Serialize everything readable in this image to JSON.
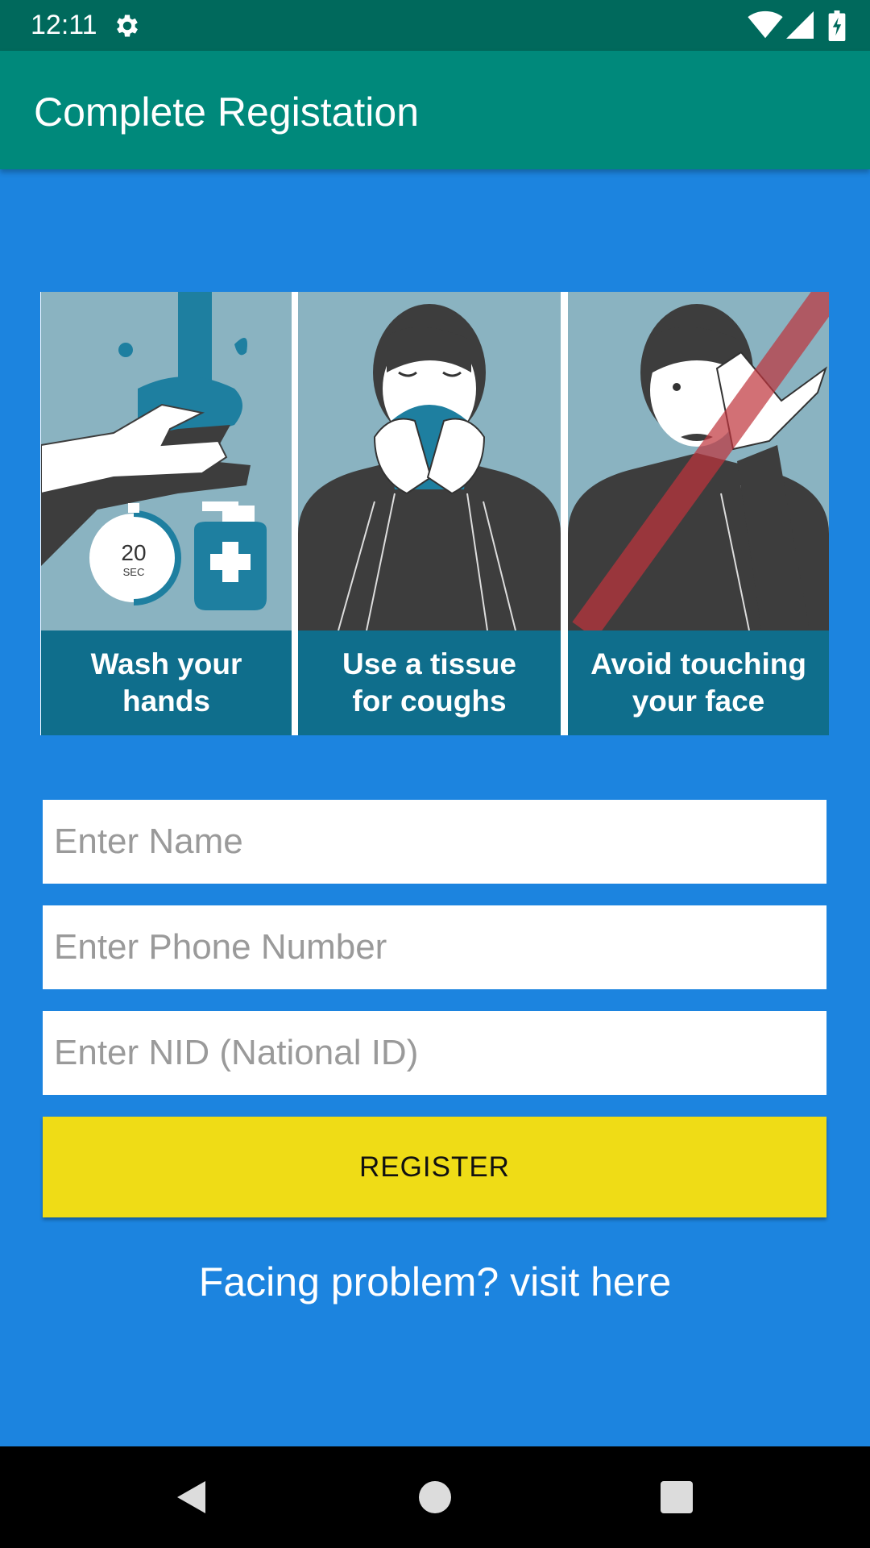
{
  "status_bar": {
    "time": "12:11",
    "icons": [
      "settings-gear-icon",
      "wifi-icon",
      "cell-signal-icon",
      "battery-charging-icon"
    ]
  },
  "app_bar": {
    "title": "Complete Registation"
  },
  "banner": {
    "panels": [
      {
        "caption": "Wash your\nhands",
        "timer_number": "20",
        "timer_unit": "SEC"
      },
      {
        "caption": "Use a tissue\nfor coughs"
      },
      {
        "caption": "Avoid touching\nyour face"
      }
    ],
    "colors": {
      "art_bg": "#8ab3c1",
      "caption_bg": "#0f6e8c",
      "accent": "#1e7fa0"
    }
  },
  "form": {
    "name_placeholder": "Enter Name",
    "phone_placeholder": "Enter Phone Number",
    "nid_placeholder": "Enter NID (National ID)",
    "register_label": "REGISTER",
    "help_text": "Facing problem? visit here"
  },
  "nav": {
    "icons": [
      "back-icon",
      "home-icon",
      "recents-icon"
    ]
  },
  "colors": {
    "status_bar": "#00695c",
    "app_bar": "#00897b",
    "background": "#1c84df",
    "button": "#efdc16"
  }
}
